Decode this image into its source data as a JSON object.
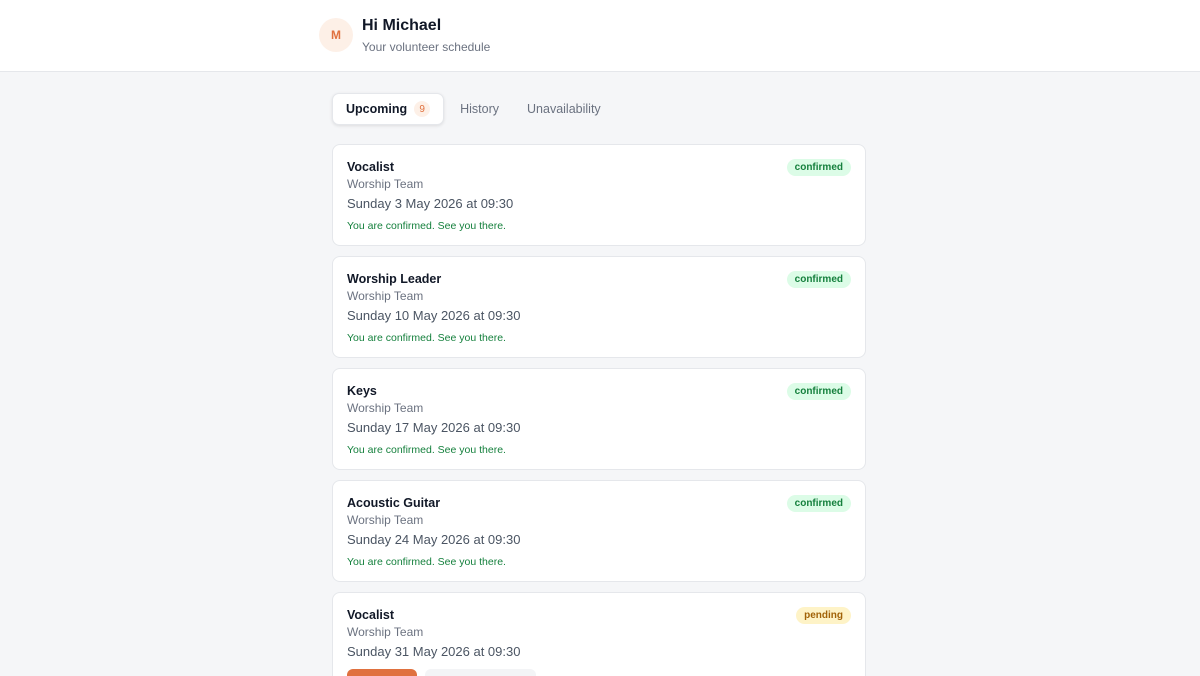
{
  "header": {
    "avatar_initial": "M",
    "greeting": "Hi Michael",
    "subtitle": "Your volunteer schedule"
  },
  "tabs": [
    {
      "label": "Upcoming",
      "count": "9",
      "active": true
    },
    {
      "label": "History",
      "active": false
    },
    {
      "label": "Unavailability",
      "active": false
    }
  ],
  "assignments": [
    {
      "role": "Vocalist",
      "team": "Worship Team",
      "date": "Sunday 3 May 2026 at 09:30",
      "status": "confirmed",
      "note": "You are confirmed. See you there."
    },
    {
      "role": "Worship Leader",
      "team": "Worship Team",
      "date": "Sunday 10 May 2026 at 09:30",
      "status": "confirmed",
      "note": "You are confirmed. See you there."
    },
    {
      "role": "Keys",
      "team": "Worship Team",
      "date": "Sunday 17 May 2026 at 09:30",
      "status": "confirmed",
      "note": "You are confirmed. See you there."
    },
    {
      "role": "Acoustic Guitar",
      "team": "Worship Team",
      "date": "Sunday 24 May 2026 at 09:30",
      "status": "confirmed",
      "note": "You are confirmed. See you there."
    },
    {
      "role": "Vocalist",
      "team": "Worship Team",
      "date": "Sunday 31 May 2026 at 09:30",
      "status": "pending",
      "note": ""
    }
  ],
  "colors": {
    "accent": "#e0713f",
    "confirmed_bg": "#dcfce7",
    "confirmed_text": "#15803d",
    "pending_bg": "#fef3c7",
    "pending_text": "#a16207"
  }
}
